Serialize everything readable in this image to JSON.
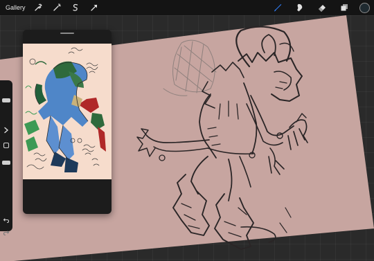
{
  "topbar": {
    "gallery_label": "Gallery",
    "left_tools": [
      "wrench-icon",
      "magic-wand-icon",
      "selection-icon",
      "transform-arrow-icon"
    ],
    "right_tools": [
      "brush-icon",
      "smudge-icon",
      "eraser-icon",
      "layers-icon"
    ],
    "active_tool": "brush-icon",
    "active_color": "#1f2a30",
    "accent": "#2f7bf5"
  },
  "canvas": {
    "paper_color": "#c7a5a0",
    "workspace_color": "#2a2a2a"
  },
  "reference": {
    "background": "#f6dccc"
  },
  "sidebar": {
    "buttons": [
      "expand-arrow-icon",
      "modify-square-icon",
      "undo-icon",
      "redo-icon"
    ]
  }
}
